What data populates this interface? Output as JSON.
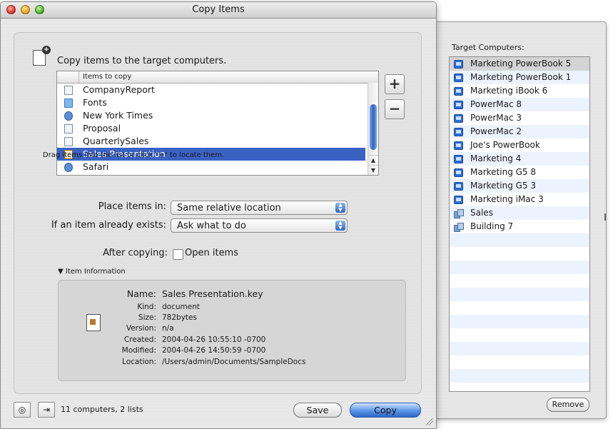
{
  "window": {
    "title": "Copy Items"
  },
  "header": {
    "text": "Copy items to the target computers."
  },
  "items_list": {
    "column_header": "Items to copy",
    "rows": [
      {
        "label": "CompanyReport",
        "icon": "document-icon"
      },
      {
        "label": "Fonts",
        "icon": "folder-icon"
      },
      {
        "label": "New York Times",
        "icon": "web-document-icon"
      },
      {
        "label": "Proposal",
        "icon": "document-icon"
      },
      {
        "label": "QuarterlySales",
        "icon": "spreadsheet-icon"
      },
      {
        "label": "Sales Presentation",
        "icon": "keynote-icon",
        "selected": true
      },
      {
        "label": "Safari",
        "icon": "safari-icon"
      }
    ]
  },
  "add_label": "+",
  "remove_item_label": "−",
  "hint": "Drag items into the list or click \"+\" to locate them.",
  "place_items": {
    "label": "Place items in:",
    "value": "Same relative location"
  },
  "if_exists": {
    "label": "If an item already exists:",
    "value": "Ask what to do"
  },
  "after_copying": {
    "label": "After copying:",
    "checkbox_label": "Open items",
    "checked": false
  },
  "item_information": {
    "toggle_label": "Item Information",
    "name_label": "Name:",
    "name_value": "Sales Presentation.key",
    "fields": [
      {
        "key": "Kind:",
        "value": "document"
      },
      {
        "key": "Size:",
        "value": "782bytes"
      },
      {
        "key": "Version:",
        "value": "n/a"
      },
      {
        "key": "Created:",
        "value": "2004-04-26 10:55:10 -0700"
      },
      {
        "key": "Modified:",
        "value": "2004-04-26 14:50:59 -0700"
      },
      {
        "key": "Location:",
        "value": "/Users/admin/Documents/SampleDocs"
      }
    ]
  },
  "footer": {
    "status": "11 computers, 2 lists",
    "save_label": "Save",
    "copy_label": "Copy"
  },
  "targets": {
    "label": "Target Computers:",
    "rows": [
      {
        "label": "Marketing PowerBook 5",
        "type": "computer",
        "selected": true
      },
      {
        "label": "Marketing PowerBook 1",
        "type": "computer"
      },
      {
        "label": "Marketing iBook 6",
        "type": "computer"
      },
      {
        "label": "PowerMac 8",
        "type": "computer"
      },
      {
        "label": "PowerMac 3",
        "type": "computer"
      },
      {
        "label": "PowerMac 2",
        "type": "computer"
      },
      {
        "label": "Joe's PowerBook",
        "type": "computer"
      },
      {
        "label": "Marketing 4",
        "type": "computer"
      },
      {
        "label": "Marketing G5 8",
        "type": "computer"
      },
      {
        "label": "Marketing G5 3",
        "type": "computer"
      },
      {
        "label": "Marketing iMac 3",
        "type": "computer"
      },
      {
        "label": "Sales",
        "type": "list"
      },
      {
        "label": "Building 7",
        "type": "list"
      }
    ],
    "remove_label": "Remove"
  },
  "colors": {
    "selection": "#3a62c3",
    "accent": "#2d68c8"
  }
}
